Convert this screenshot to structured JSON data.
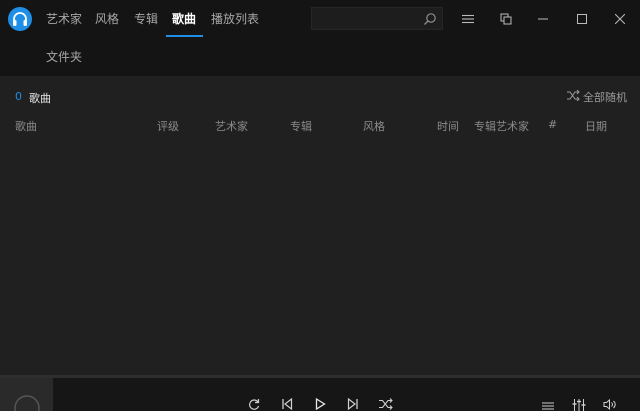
{
  "nav": {
    "tabs": [
      {
        "label": "艺术家"
      },
      {
        "label": "风格"
      },
      {
        "label": "专辑"
      },
      {
        "label": "歌曲"
      },
      {
        "label": "播放列表"
      }
    ],
    "active_tab": "歌曲",
    "folder_tab": "文件夹"
  },
  "search": {
    "value": "",
    "placeholder": ""
  },
  "songs": {
    "count": "0",
    "label": "歌曲",
    "shuffle_all": "全部随机"
  },
  "table": {
    "columns": [
      "歌曲",
      "评级",
      "艺术家",
      "专辑",
      "风格",
      "时间",
      "专辑艺术家",
      "#",
      "日期"
    ],
    "rows": []
  },
  "colors": {
    "accent": "#1f8ee6",
    "background": "#202020",
    "titlebar": "#141414"
  },
  "icons": {
    "logo": "headphones-logo-icon",
    "search": "search-icon",
    "menu": "hamburger-menu-icon",
    "compact": "compact-overlay-icon",
    "minimize": "minimize-icon",
    "maximize": "maximize-icon",
    "close": "close-icon",
    "shuffle": "shuffle-icon",
    "repeat": "repeat-icon",
    "previous": "previous-icon",
    "play": "play-icon",
    "next": "next-icon",
    "queue": "playlist-queue-icon",
    "equalizer": "equalizer-icon",
    "volume": "volume-icon"
  }
}
